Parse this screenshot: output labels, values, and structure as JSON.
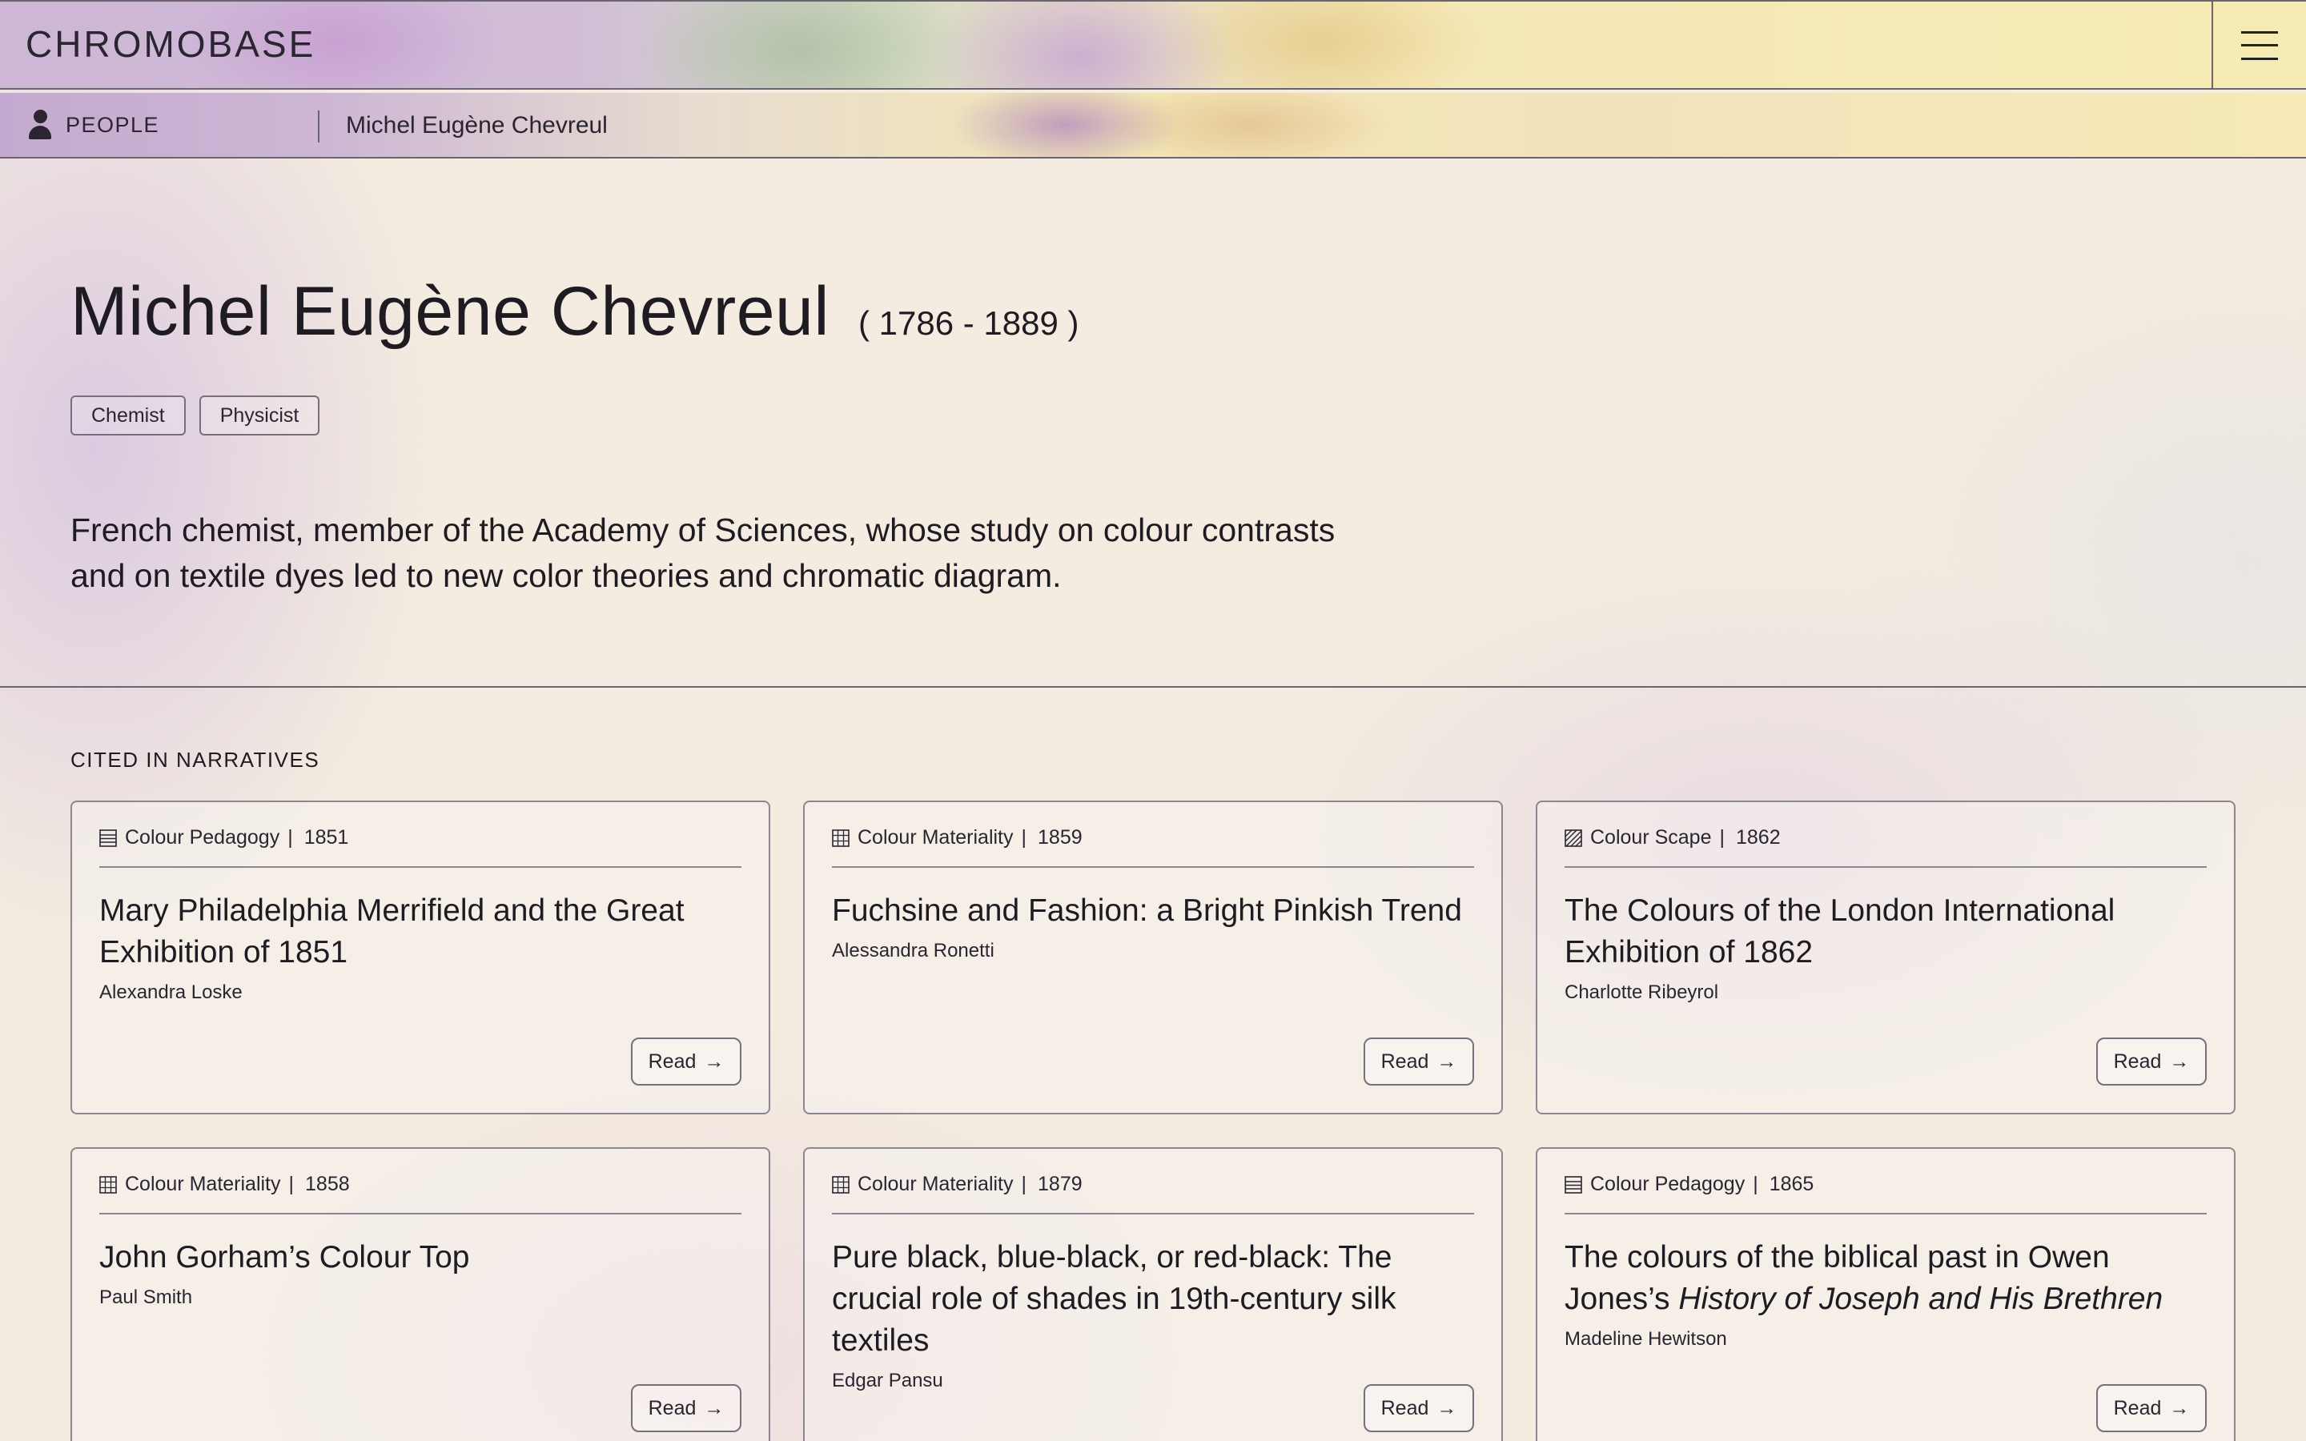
{
  "header": {
    "logo": "CHROMOBASE",
    "menu_icon": "hamburger-icon"
  },
  "breadcrumb": {
    "section": "PEOPLE",
    "section_icon": "person-icon",
    "current": "Michel Eugène Chevreul"
  },
  "person": {
    "name": "Michel Eugène Chevreul",
    "dates": "( 1786 - 1889 )",
    "tags": [
      "Chemist",
      "Physicist"
    ],
    "bio": "French chemist, member of the Academy of Sciences, whose study on colour contrasts and on textile dyes led to new color theories and chromatic diagram."
  },
  "narratives": {
    "section_title": "CITED IN NARRATIVES",
    "read_label": "Read",
    "read_arrow": "→",
    "pipe": "|",
    "cards": [
      {
        "category": "Colour Pedagogy",
        "icon": "lined-page-icon",
        "year": "1851",
        "title": "Mary Philadelphia Merrifield and the Great Exhibition of 1851",
        "title_em": "",
        "author": "Alexandra Loske"
      },
      {
        "category": "Colour Materiality",
        "icon": "grid-icon",
        "year": "1859",
        "title": "Fuchsine and Fashion: a Bright Pinkish Trend",
        "title_em": "",
        "author": "Alessandra Ronetti"
      },
      {
        "category": "Colour Scape",
        "icon": "hatched-square-icon",
        "year": "1862",
        "title": "The Colours of the London International Exhibition of 1862",
        "title_em": "",
        "author": "Charlotte Ribeyrol"
      },
      {
        "category": "Colour Materiality",
        "icon": "grid-icon",
        "year": "1858",
        "title": "John Gorham’s Colour Top",
        "title_em": "",
        "author": "Paul Smith"
      },
      {
        "category": "Colour Materiality",
        "icon": "grid-icon",
        "year": "1879",
        "title": "Pure black, blue-black, or red-black: The crucial role of shades in 19th-century silk textiles",
        "title_em": "",
        "author": "Edgar Pansu"
      },
      {
        "category": "Colour Pedagogy",
        "icon": "lined-page-icon",
        "year": "1865",
        "title": "The colours of the biblical past in Owen Jones’s ",
        "title_em": "History of Joseph and His Brethren",
        "author": "Madeline Hewitson"
      }
    ]
  }
}
